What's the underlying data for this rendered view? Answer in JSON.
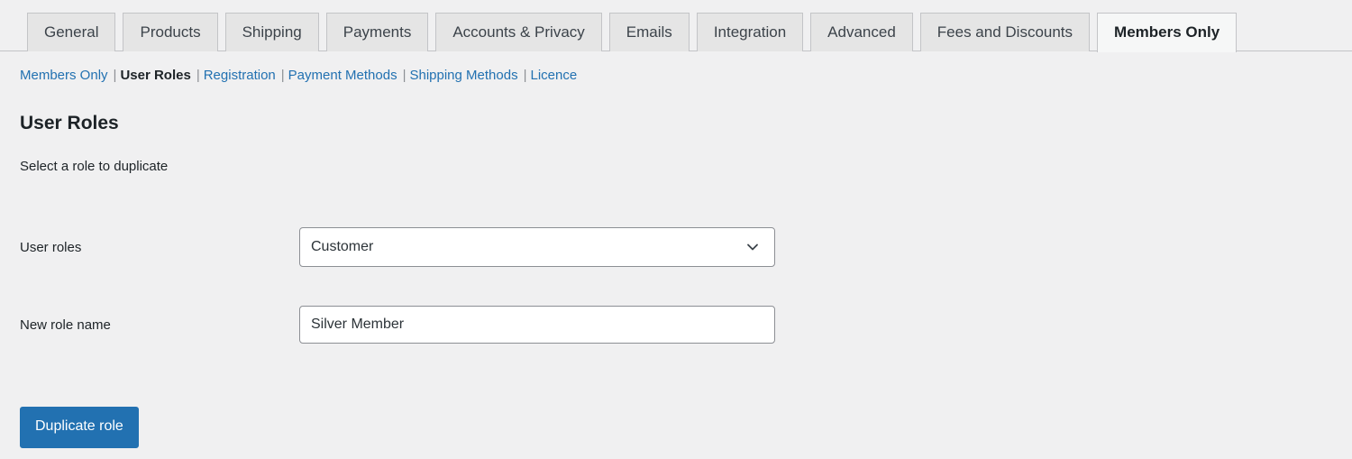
{
  "tabs": [
    {
      "label": "General",
      "active": false
    },
    {
      "label": "Products",
      "active": false
    },
    {
      "label": "Shipping",
      "active": false
    },
    {
      "label": "Payments",
      "active": false
    },
    {
      "label": "Accounts & Privacy",
      "active": false
    },
    {
      "label": "Emails",
      "active": false
    },
    {
      "label": "Integration",
      "active": false
    },
    {
      "label": "Advanced",
      "active": false
    },
    {
      "label": "Fees and Discounts",
      "active": false
    },
    {
      "label": "Members Only",
      "active": true
    }
  ],
  "subnav": {
    "items": [
      {
        "label": "Members Only",
        "current": false
      },
      {
        "label": "User Roles",
        "current": true
      },
      {
        "label": "Registration",
        "current": false
      },
      {
        "label": "Payment Methods",
        "current": false
      },
      {
        "label": "Shipping Methods",
        "current": false
      },
      {
        "label": "Licence",
        "current": false
      }
    ],
    "separator": "|"
  },
  "page": {
    "title": "User Roles",
    "description": "Select a role to duplicate"
  },
  "form": {
    "user_roles": {
      "label": "User roles",
      "selected": "Customer"
    },
    "new_role_name": {
      "label": "New role name",
      "value": "Silver Member",
      "placeholder": ""
    }
  },
  "actions": {
    "duplicate_role": "Duplicate role"
  },
  "colors": {
    "link": "#2271b1",
    "primary_button": "#2271b1",
    "background": "#f0f0f1",
    "tab_inactive": "#e5e5e5",
    "tab_active": "#f6f7f7",
    "border": "#c3c4c7"
  }
}
